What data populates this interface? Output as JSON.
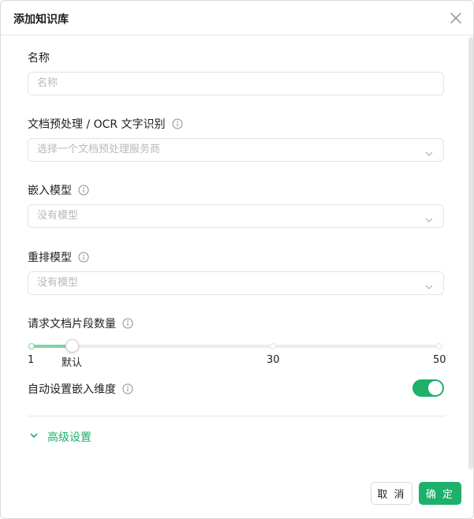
{
  "dialog": {
    "title": "添加知识库",
    "close_icon": "close-icon"
  },
  "form": {
    "name": {
      "label": "名称",
      "placeholder": "名称"
    },
    "preprocess": {
      "label": "文档预处理 / OCR 文字识别",
      "placeholder": "选择一个文档预处理服务商"
    },
    "embedding": {
      "label": "嵌入模型",
      "placeholder": "没有模型"
    },
    "rerank": {
      "label": "重排模型",
      "placeholder": "没有模型"
    },
    "doc_count": {
      "label": "请求文档片段数量",
      "min": 1,
      "max": 50,
      "value": 6,
      "marks": {
        "min": "1",
        "default": "默认",
        "mid": "30",
        "max": "50"
      }
    },
    "auto_dim": {
      "label": "自动设置嵌入维度",
      "enabled": true
    }
  },
  "advanced": {
    "label": "高级设置"
  },
  "buttons": {
    "cancel": "取 消",
    "ok": "确 定"
  },
  "colors": {
    "accent": "#1db06a",
    "slider_fill": "#7fd3a4"
  }
}
